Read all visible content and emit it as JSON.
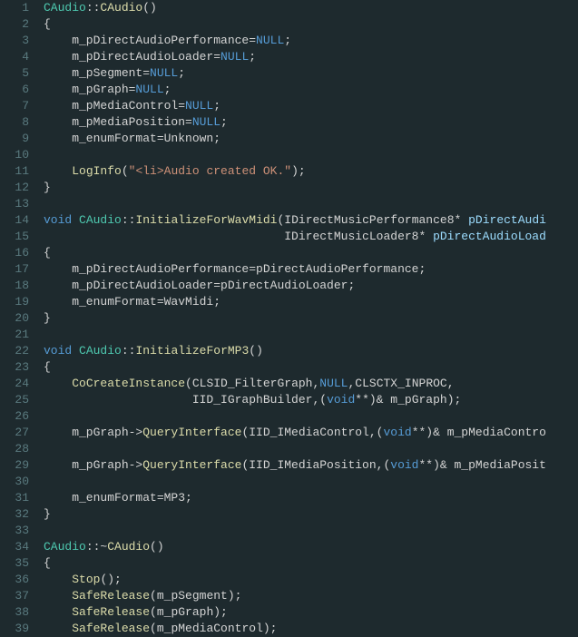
{
  "lines": [
    {
      "n": 1,
      "html": "<span class='type'>CAudio</span>::<span class='func'>CAudio</span>()"
    },
    {
      "n": 2,
      "html": "{"
    },
    {
      "n": 3,
      "html": "    m_pDirectAudioPerformance=<span class='null'>NULL</span>;"
    },
    {
      "n": 4,
      "html": "    m_pDirectAudioLoader=<span class='null'>NULL</span>;"
    },
    {
      "n": 5,
      "html": "    m_pSegment=<span class='null'>NULL</span>;"
    },
    {
      "n": 6,
      "html": "    m_pGraph=<span class='null'>NULL</span>;"
    },
    {
      "n": 7,
      "html": "    m_pMediaControl=<span class='null'>NULL</span>;"
    },
    {
      "n": 8,
      "html": "    m_pMediaPosition=<span class='null'>NULL</span>;"
    },
    {
      "n": 9,
      "html": "    m_enumFormat=Unknown;"
    },
    {
      "n": 10,
      "html": ""
    },
    {
      "n": 11,
      "html": "    <span class='func'>LogInfo</span>(<span class='str'>\"&lt;li&gt;Audio created OK.\"</span>);"
    },
    {
      "n": 12,
      "html": "}"
    },
    {
      "n": 13,
      "html": ""
    },
    {
      "n": 14,
      "html": "<span class='kw'>void</span> <span class='type'>CAudio</span>::<span class='func'>InitializeForWavMidi</span>(IDirectMusicPerformance8* <span class='param'>pDirectAudi</span>"
    },
    {
      "n": 15,
      "html": "                                  IDirectMusicLoader8* <span class='param'>pDirectAudioLoad</span>"
    },
    {
      "n": 16,
      "html": "{"
    },
    {
      "n": 17,
      "html": "    m_pDirectAudioPerformance=pDirectAudioPerformance;"
    },
    {
      "n": 18,
      "html": "    m_pDirectAudioLoader=pDirectAudioLoader;"
    },
    {
      "n": 19,
      "html": "    m_enumFormat=WavMidi;"
    },
    {
      "n": 20,
      "html": "}"
    },
    {
      "n": 21,
      "html": ""
    },
    {
      "n": 22,
      "html": "<span class='kw'>void</span> <span class='type'>CAudio</span>::<span class='func'>InitializeForMP3</span>()"
    },
    {
      "n": 23,
      "html": "{"
    },
    {
      "n": 24,
      "html": "    <span class='func'>CoCreateInstance</span>(CLSID_FilterGraph,<span class='null'>NULL</span>,CLSCTX_INPROC,"
    },
    {
      "n": 25,
      "html": "                     IID_IGraphBuilder,(<span class='kw'>void</span>**)&amp; m_pGraph);"
    },
    {
      "n": 26,
      "html": ""
    },
    {
      "n": 27,
      "html": "    m_pGraph-&gt;<span class='func'>QueryInterface</span>(IID_IMediaControl,(<span class='kw'>void</span>**)&amp; m_pMediaContro"
    },
    {
      "n": 28,
      "html": ""
    },
    {
      "n": 29,
      "html": "    m_pGraph-&gt;<span class='func'>QueryInterface</span>(IID_IMediaPosition,(<span class='kw'>void</span>**)&amp; m_pMediaPosit"
    },
    {
      "n": 30,
      "html": ""
    },
    {
      "n": 31,
      "html": "    m_enumFormat=MP3;"
    },
    {
      "n": 32,
      "html": "}"
    },
    {
      "n": 33,
      "html": ""
    },
    {
      "n": 34,
      "html": "<span class='type'>CAudio</span>::~<span class='func'>CAudio</span>()"
    },
    {
      "n": 35,
      "html": "{"
    },
    {
      "n": 36,
      "html": "    <span class='func'>Stop</span>();"
    },
    {
      "n": 37,
      "html": "    <span class='func'>SafeRelease</span>(m_pSegment);"
    },
    {
      "n": 38,
      "html": "    <span class='func'>SafeRelease</span>(m_pGraph);"
    },
    {
      "n": 39,
      "html": "    <span class='func'>SafeRelease</span>(m_pMediaControl);"
    }
  ]
}
